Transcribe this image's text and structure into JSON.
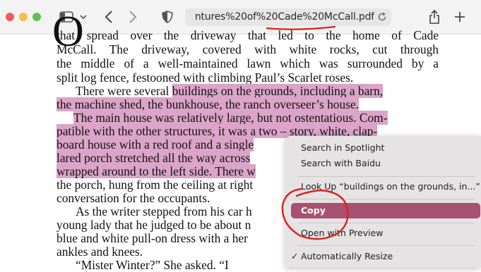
{
  "browser": {
    "url": "ntures%20of%20Cade%20McCall.pdf",
    "colors": {
      "close": "#ec5f57",
      "minimize": "#f4bd4f",
      "zoom": "#5fc44f"
    },
    "icons": [
      "sidebar-icon",
      "chevron-down-icon",
      "back-icon",
      "forward-icon",
      "shield-icon",
      "reload-icon",
      "share-icon",
      "new-tab-icon"
    ]
  },
  "document": {
    "dropcap": "O",
    "lines": [
      {
        "text": "that spread over the driveway that led to the home of Cade"
      },
      {
        "text": "McCall. The driveway, covered with white rocks, cut through"
      },
      {
        "text": "the middle of a well-maintained lawn which was surrounded by a"
      },
      {
        "text": "split log fence, festooned with climbing Paul’s Scarlet roses."
      },
      {
        "plain": "There were several ",
        "highlight": "buildings on the grounds, including a barn,"
      },
      {
        "highlight": "the machine shed, the bunkhouse, the ranch overseer’s house."
      },
      {
        "highlight": "The main house was relatively large, but not ostentatious. Com-"
      },
      {
        "highlight": "patible with the other structures, it was a two – story, white, clap-"
      },
      {
        "highlight": "board house with a red roof and a single"
      },
      {
        "highlight": "lared porch stretched all the way across"
      },
      {
        "highlight": "wrapped around to the left side. There w"
      },
      {
        "plain": "the porch, hung from the ceiling at right"
      },
      {
        "plain": "conversation for the occupants."
      },
      {
        "plain": "As the writer stepped from his car h"
      },
      {
        "plain": "young lady that he judged to be about n"
      },
      {
        "plain": "blue and white pull-on dress with a her"
      },
      {
        "plain": "ankles and knees."
      },
      {
        "plain": "“Mister Winter?” She asked. “I"
      }
    ]
  },
  "context_menu": {
    "items": [
      {
        "label": "Search in Spotlight"
      },
      {
        "label": "Search with Baidu"
      },
      {
        "label": "Look Up “buildings on the grounds, in...”"
      },
      {
        "label": "Copy"
      },
      {
        "label": "Open with Preview"
      },
      {
        "label": "Automatically Resize",
        "checked": true,
        "check": "✓"
      }
    ],
    "highlight_color": "#a8506f"
  },
  "annotations": {
    "color": "#e0201c"
  }
}
